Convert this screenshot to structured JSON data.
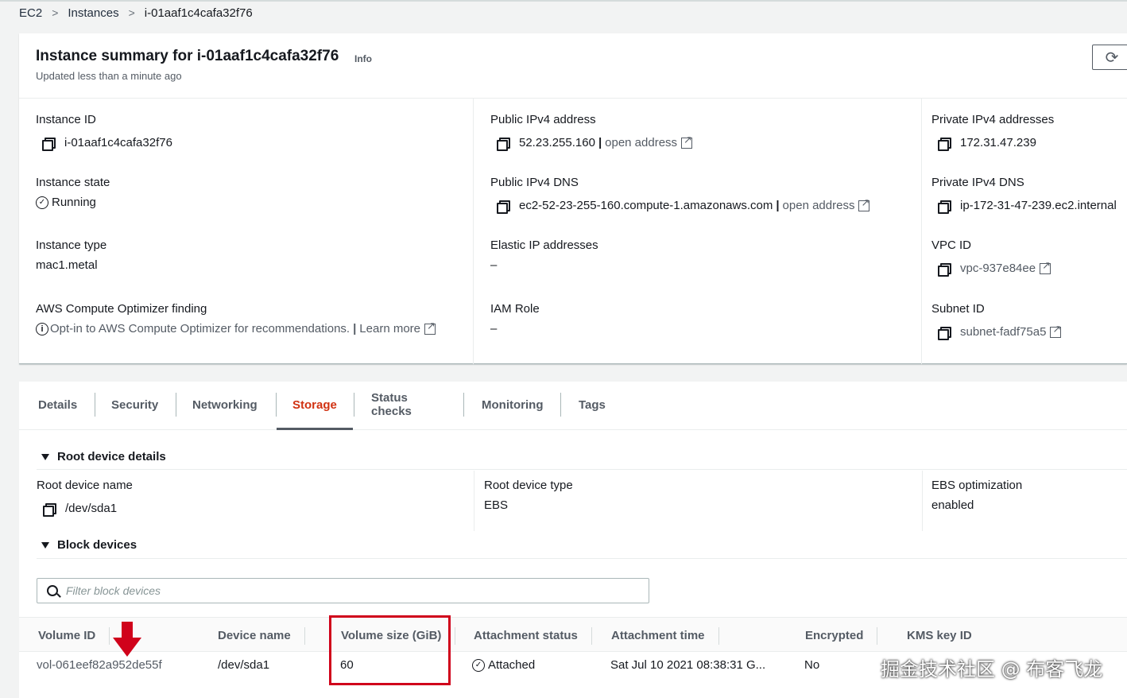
{
  "breadcrumb": {
    "items": [
      "EC2",
      "Instances",
      "i-01aaf1c4cafa32f76"
    ]
  },
  "summary": {
    "title": "Instance summary for i-01aaf1c4cafa32f76",
    "info_label": "Info",
    "updated": "Updated less than a minute ago",
    "col1": {
      "instance_id_label": "Instance ID",
      "instance_id": "i-01aaf1c4cafa32f76",
      "instance_state_label": "Instance state",
      "instance_state": "Running",
      "instance_type_label": "Instance type",
      "instance_type": "mac1.metal",
      "optimizer_label": "AWS Compute Optimizer finding",
      "optimizer_text": "Opt-in to AWS Compute Optimizer for recommendations.",
      "optimizer_link": "Learn more"
    },
    "col2": {
      "public_ipv4_label": "Public IPv4 address",
      "public_ipv4": "52.23.255.160",
      "open_address": "open address",
      "public_dns_label": "Public IPv4 DNS",
      "public_dns": "ec2-52-23-255-160.compute-1.amazonaws.com",
      "elastic_ip_label": "Elastic IP addresses",
      "elastic_ip": "–",
      "iam_role_label": "IAM Role",
      "iam_role": "–"
    },
    "col3": {
      "private_ipv4_label": "Private IPv4 addresses",
      "private_ipv4": "172.31.47.239",
      "private_dns_label": "Private IPv4 DNS",
      "private_dns": "ip-172-31-47-239.ec2.internal",
      "vpc_id_label": "VPC ID",
      "vpc_id": "vpc-937e84ee",
      "subnet_id_label": "Subnet ID",
      "subnet_id": "subnet-fadf75a5"
    }
  },
  "tabs": [
    {
      "label": "Details"
    },
    {
      "label": "Security"
    },
    {
      "label": "Networking"
    },
    {
      "label": "Storage",
      "active": true
    },
    {
      "label": "Status checks"
    },
    {
      "label": "Monitoring"
    },
    {
      "label": "Tags"
    }
  ],
  "storage": {
    "root_section_title": "Root device details",
    "root_device_name_label": "Root device name",
    "root_device_name": "/dev/sda1",
    "root_device_type_label": "Root device type",
    "root_device_type": "EBS",
    "ebs_opt_label": "EBS optimization",
    "ebs_opt": "enabled",
    "block_section_title": "Block devices",
    "filter_placeholder": "Filter block devices",
    "columns": [
      "Volume ID",
      "Device name",
      "Volume size (GiB)",
      "Attachment status",
      "Attachment time",
      "Encrypted",
      "KMS key ID"
    ],
    "rows": [
      {
        "volume_id": "vol-061eef82a952de55f",
        "device_name": "/dev/sda1",
        "size": "60",
        "status": "Attached",
        "time": "Sat Jul 10 2021 08:38:31 G...",
        "encrypted": "No",
        "kms": ""
      }
    ]
  },
  "colors": {
    "accent": "#d13212",
    "highlight": "#d0021b"
  },
  "watermark": "掘金技术社区 @ 布客飞龙"
}
